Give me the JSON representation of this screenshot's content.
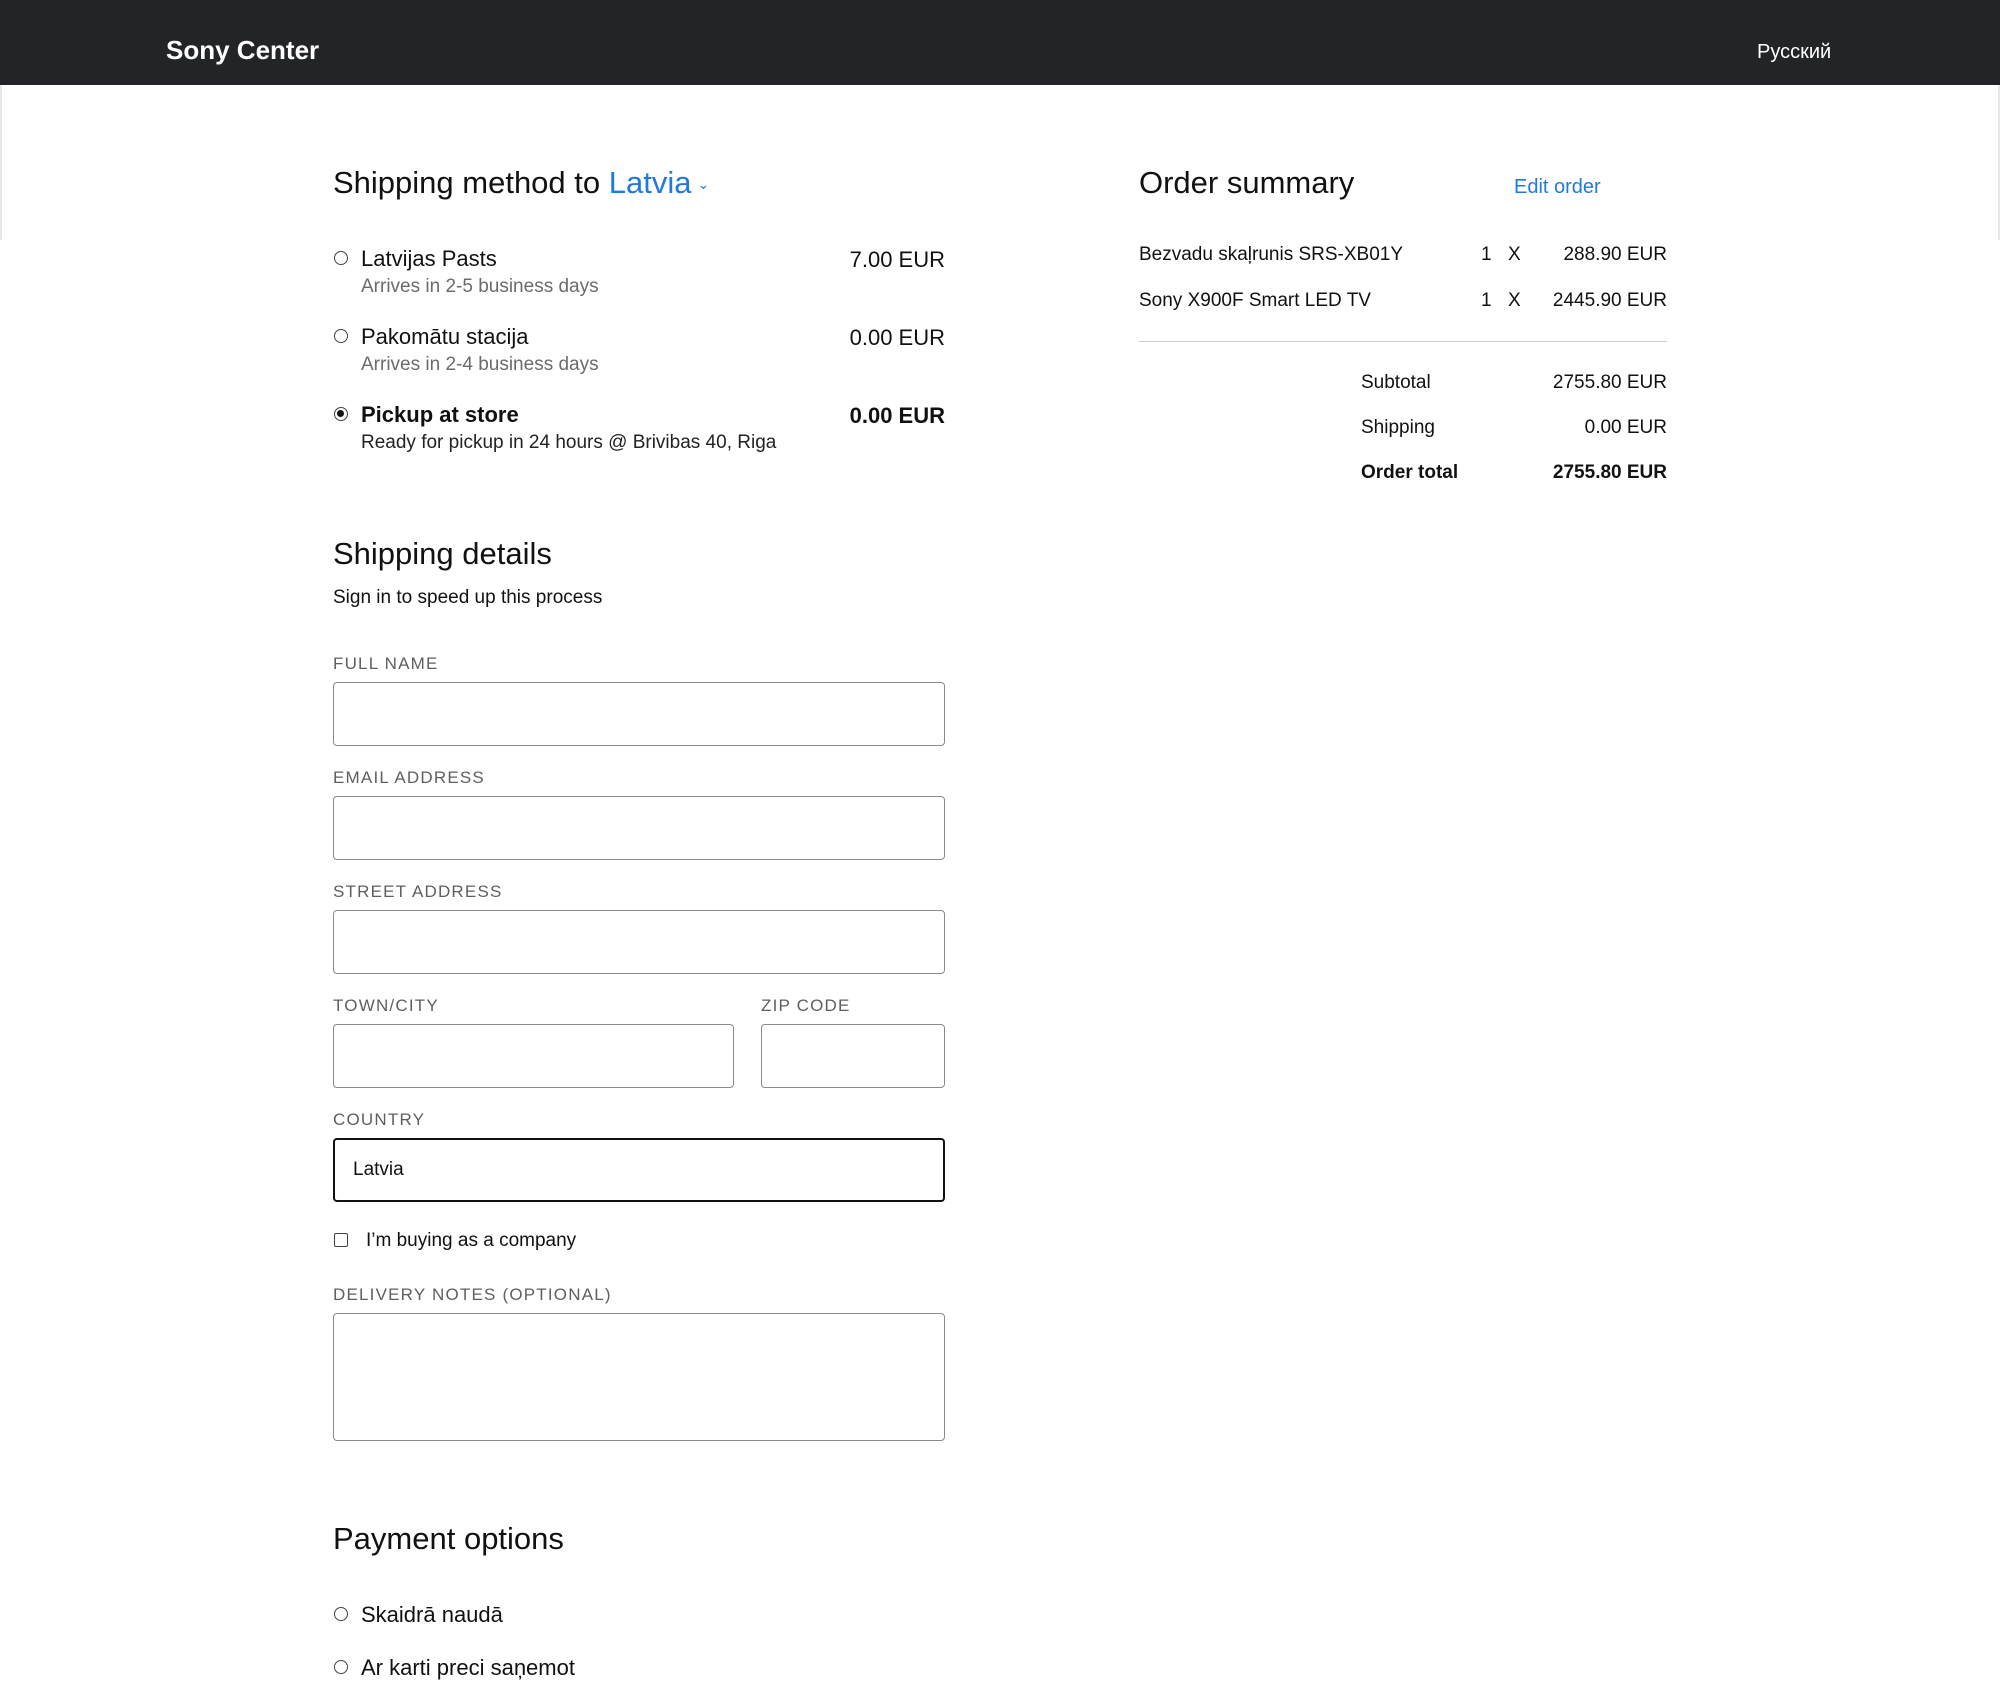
{
  "header": {
    "brand": "Sony Center",
    "language": "Русский"
  },
  "shipping_method": {
    "title_prefix": "Shipping method to",
    "country": "Latvia",
    "options": [
      {
        "title": "Latvijas Pasts",
        "subtitle": "Arrives in 2-5 business days",
        "price": "7.00 EUR",
        "selected": false
      },
      {
        "title": "Pakomātu stacija",
        "subtitle": "Arrives in 2-4 business days",
        "price": "0.00 EUR",
        "selected": false
      },
      {
        "title": "Pickup at store",
        "subtitle": "Ready for pickup in 24 hours @ Brivibas 40, Riga",
        "price": "0.00 EUR",
        "selected": true
      }
    ]
  },
  "order_summary": {
    "title": "Order summary",
    "edit_label": "Edit order",
    "items": [
      {
        "name": "Bezvadu skaļrunis SRS-XB01Y",
        "qty": "1",
        "times": "X",
        "price": "288.90 EUR"
      },
      {
        "name": "Sony X900F Smart LED TV",
        "qty": "1",
        "times": "X",
        "price": "2445.90 EUR"
      }
    ],
    "subtotal_label": "Subtotal",
    "subtotal_value": "2755.80 EUR",
    "shipping_label": "Shipping",
    "shipping_value": "0.00 EUR",
    "total_label": "Order total",
    "total_value": "2755.80 EUR"
  },
  "shipping_details": {
    "title": "Shipping details",
    "subtitle": "Sign in to speed up this process",
    "full_name_label": "FULL NAME",
    "full_name_value": "",
    "email_label": "EMAIL ADDRESS",
    "email_value": "",
    "street_label": "STREET ADDRESS",
    "street_value": "",
    "town_label": "TOWN/CITY",
    "town_value": "",
    "zip_label": "ZIP CODE",
    "zip_value": "",
    "country_label": "COUNTRY",
    "country_value": "Latvia",
    "company_checkbox_label": "I’m buying as a company",
    "company_checked": false,
    "notes_label": "DELIVERY NOTES (OPTIONAL)",
    "notes_value": ""
  },
  "payment": {
    "title": "Payment options",
    "options": [
      {
        "label": "Skaidrā naudā",
        "selected": false
      },
      {
        "label": "Ar karti preci saņemot",
        "selected": false
      }
    ]
  }
}
